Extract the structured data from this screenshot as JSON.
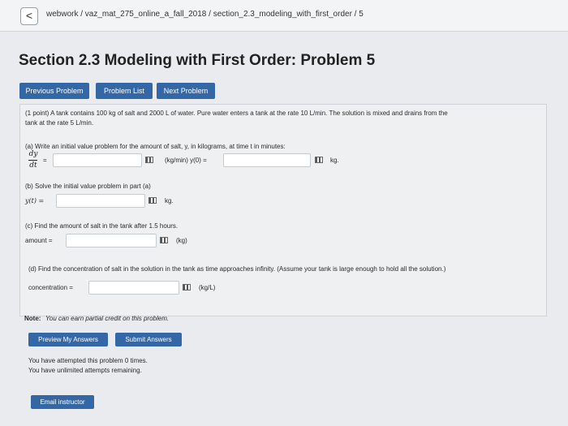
{
  "nav": {
    "back_glyph": "<",
    "breadcrumb": "webwork / vaz_mat_275_online_a_fall_2018 / section_2.3_modeling_with_first_order / 5"
  },
  "page_title": "Section 2.3 Modeling with First Order: Problem 5",
  "buttons": {
    "previous": "Previous Problem",
    "list": "Problem List",
    "next": "Next Problem",
    "preview": "Preview My Answers",
    "submit": "Submit Answers",
    "email": "Email instructor"
  },
  "problem": {
    "intro_line1": "(1 point) A tank contains 100 kg of salt and 2000 L of water. Pure water enters a tank at the rate 10 L/min. The solution is mixed and drains from the",
    "intro_line2": "tank at the rate 5 L/min.",
    "part_a_label": "(a) Write an initial value problem for the amount of salt, y, in kilograms, at time t in minutes:",
    "frac_top": "dy",
    "frac_bottom": "dt",
    "equals": "=",
    "part_a_unit": "(kg/min) y(0) =",
    "part_a_kg": "kg.",
    "part_b_label": "(b) Solve the initial value problem in part (a)",
    "part_b_lhs": "y(t) =",
    "part_b_unit": "kg.",
    "part_c_label": "(c) Find the amount of salt in the tank after 1.5 hours.",
    "part_c_lhs": "amount =",
    "part_c_unit": "(kg)",
    "part_d_label": "(d) Find the concentration of salt in the solution in the tank as time approaches infinity. (Assume your tank is large enough to hold all the solution.)",
    "part_d_lhs": "concentration =",
    "part_d_unit": "(kg/L)"
  },
  "note": {
    "bold": "Note:",
    "text": "You can earn partial credit on this problem."
  },
  "attempts": {
    "line1": "You have attempted this problem 0 times.",
    "line2": "You have unlimited attempts remaining."
  },
  "inputs": {
    "a_rate": "",
    "a_initial": "",
    "b_solution": "",
    "c_amount": "",
    "d_concentration": ""
  }
}
